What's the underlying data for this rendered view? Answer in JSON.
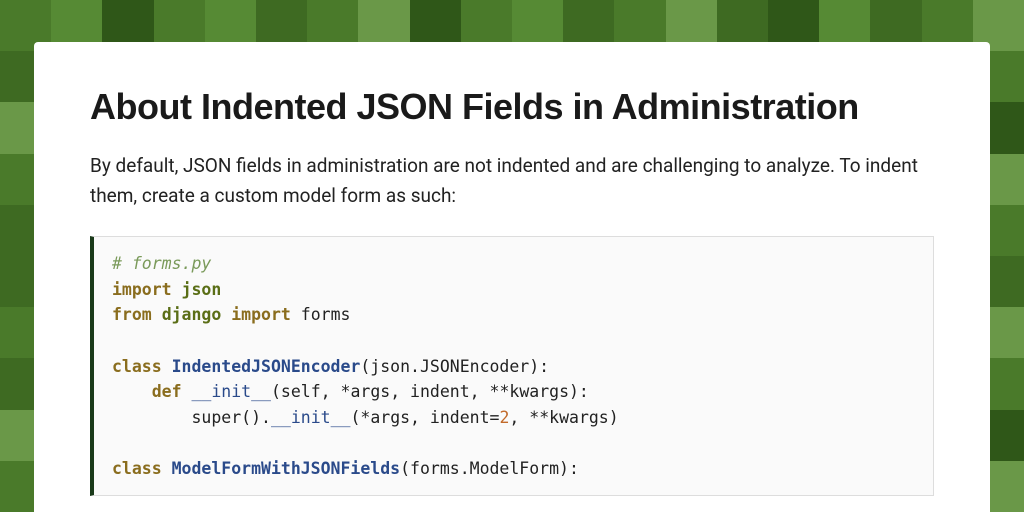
{
  "title": "About Indented JSON Fields in Administration",
  "lead": "By default, JSON fields in administration are not indented and are challenging to analyze. To indent them, create a custom model form as such:",
  "code": {
    "comment": "# forms.py",
    "kw_import1": "import",
    "mod_json": "json",
    "kw_from": "from",
    "mod_django": "django",
    "kw_import2": "import",
    "mod_forms": " forms",
    "kw_class1": "class",
    "cls_encoder": "IndentedJSONEncoder",
    "base_encoder": "(json.JSONEncoder):",
    "kw_def": "def",
    "fn_init": "__init__",
    "sig1": "(self, *args, indent, **kwargs):",
    "super1": "super().",
    "fn_init2": "__init__",
    "sig2a": "(*args, indent=",
    "indent_val": "2",
    "sig2b": ", **kwargs)",
    "kw_class2": "class",
    "cls_form": "ModelFormWithJSONFields",
    "base_form": "(forms.ModelForm):"
  }
}
